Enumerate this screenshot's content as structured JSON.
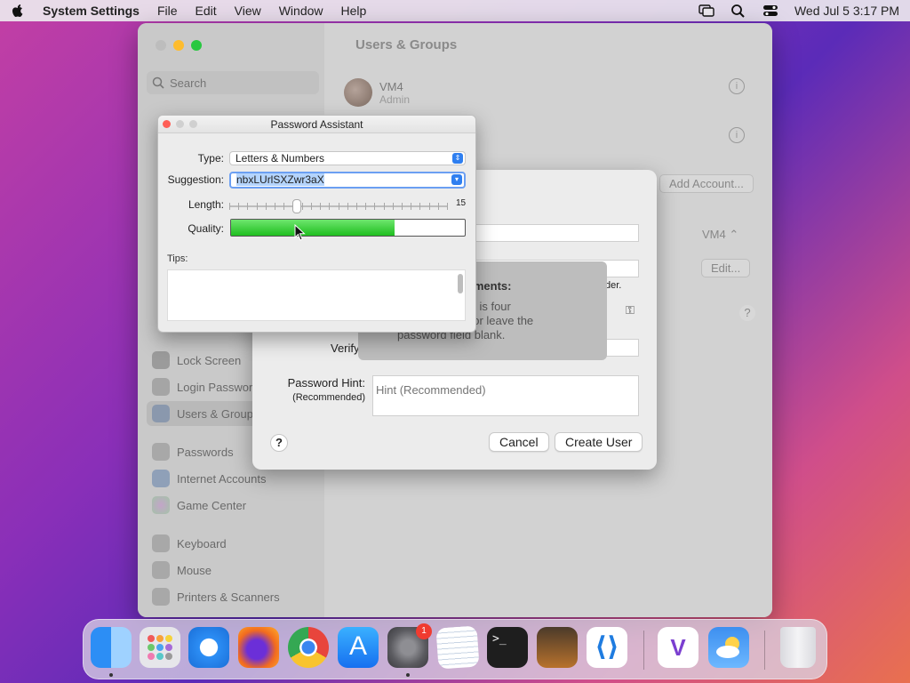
{
  "menubar": {
    "app": "System Settings",
    "items": [
      "File",
      "Edit",
      "View",
      "Window",
      "Help"
    ],
    "clock": "Wed Jul 5  3:17 PM"
  },
  "settings": {
    "title": "Users & Groups",
    "search_placeholder": "Search",
    "sidebar": [
      "Lock Screen",
      "Login Password",
      "Users & Groups",
      "Passwords",
      "Internet Accounts",
      "Game Center",
      "Keyboard",
      "Mouse",
      "Printers & Scanners"
    ],
    "user": {
      "name": "VM4",
      "role": "Admin"
    },
    "add_account": "Add Account...",
    "autologin_value": "VM4",
    "edit": "Edit...",
    "help": "?"
  },
  "sheet": {
    "fragment_der": "der.",
    "verify_label": "Verify",
    "hint_label": "Password Hint:",
    "hint_sub": "(Recommended)",
    "hint_placeholder": "Hint (Recommended)",
    "cancel": "Cancel",
    "create": "Create User",
    "help": "?",
    "tooltip": {
      "heading": "uirements:",
      "line1": "rd that is four",
      "line2": "more or leave the",
      "line3": "password field blank."
    }
  },
  "assistant": {
    "title": "Password Assistant",
    "type_label": "Type:",
    "type_value": "Letters & Numbers",
    "suggestion_label": "Suggestion:",
    "suggestion_value": "nbxLUrlSXZwr3aX",
    "length_label": "Length:",
    "length_value": "15",
    "length_fraction": 0.31,
    "quality_label": "Quality:",
    "quality_fraction": 0.7,
    "tips_label": "Tips:"
  },
  "colors": {
    "close": "#ff5f57",
    "minimize": "#febc2e",
    "zoom": "#28c840",
    "accent": "#2f7ff0"
  }
}
